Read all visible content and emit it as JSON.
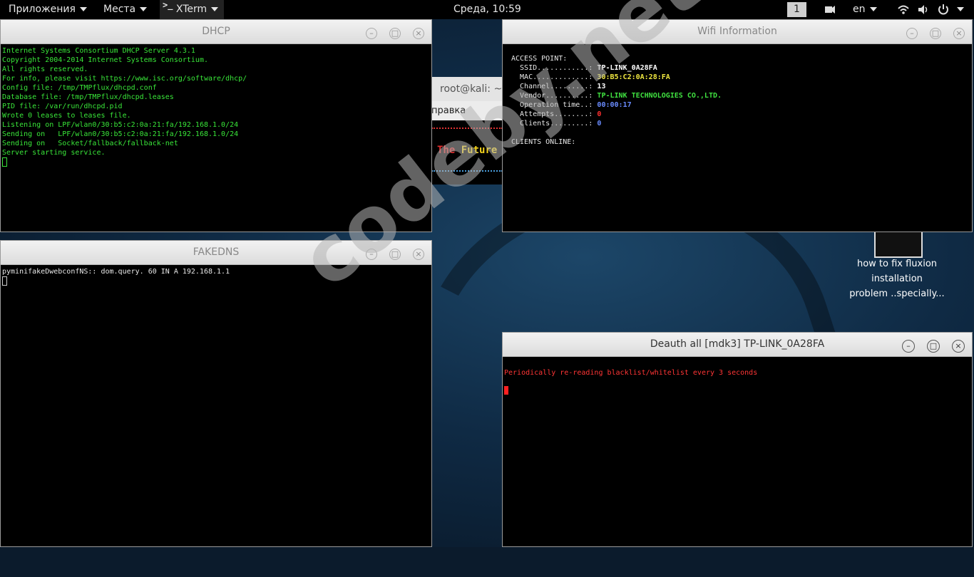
{
  "topbar": {
    "apps_label": "Приложения",
    "places_label": "Места",
    "xterm_icon": ">_",
    "xterm_label": "XTerm",
    "clock": "Среда, 10:59",
    "workspace": "1",
    "lang": "en"
  },
  "background_terminal": {
    "title": "root@kali: ~/",
    "menu_fragment": "правка",
    "banner_the": "The",
    "banner_future": "Future"
  },
  "desktop_icon": {
    "label_line1": "how to fix fluxion",
    "label_line2": "installation",
    "label_line3": "problem ..specially..."
  },
  "dhcp": {
    "title": "DHCP",
    "lines": [
      "Internet Systems Consortium DHCP Server 4.3.1",
      "Copyright 2004-2014 Internet Systems Consortium.",
      "All rights reserved.",
      "For info, please visit https://www.isc.org/software/dhcp/",
      "Config file: /tmp/TMPflux/dhcpd.conf",
      "Database file: /tmp/TMPflux/dhcpd.leases",
      "PID file: /var/run/dhcpd.pid",
      "Wrote 0 leases to leases file.",
      "Listening on LPF/wlan0/30:b5:c2:0a:21:fa/192.168.1.0/24",
      "Sending on   LPF/wlan0/30:b5:c2:0a:21:fa/192.168.1.0/24",
      "Sending on   Socket/fallback/fallback-net",
      "Server starting service."
    ]
  },
  "fakedns": {
    "title": "FAKEDNS",
    "line": "pyminifakeDwebconfNS:: dom.query. 60 IN A 192.168.1.1"
  },
  "wifi": {
    "title": "Wifi Information",
    "header": "ACCESS POINT:",
    "ssid_label": "  SSID............: ",
    "ssid": "TP-LINK_0A28FA",
    "mac_label": "  MAC.............: ",
    "mac": "30:B5:C2:0A:28:FA",
    "channel_label": "  Channel.........: ",
    "channel": "13",
    "vendor_label": "  Vendor..........: ",
    "vendor": "TP-LINK TECHNOLOGIES CO.,LTD.",
    "optime_label": "  Operation time..: ",
    "optime": "00:00:17",
    "attempts_label": "  Attempts........: ",
    "attempts": "0",
    "clients_label": "  Clients.........: ",
    "clients": "0",
    "clients_online": "CLIENTS ONLINE:"
  },
  "deauth": {
    "title": "Deauth all [mdk3]  TP-LINK_0A28FA",
    "line": "Periodically re-reading blacklist/whitelist every 3 seconds"
  },
  "watermark": "codeby.net"
}
